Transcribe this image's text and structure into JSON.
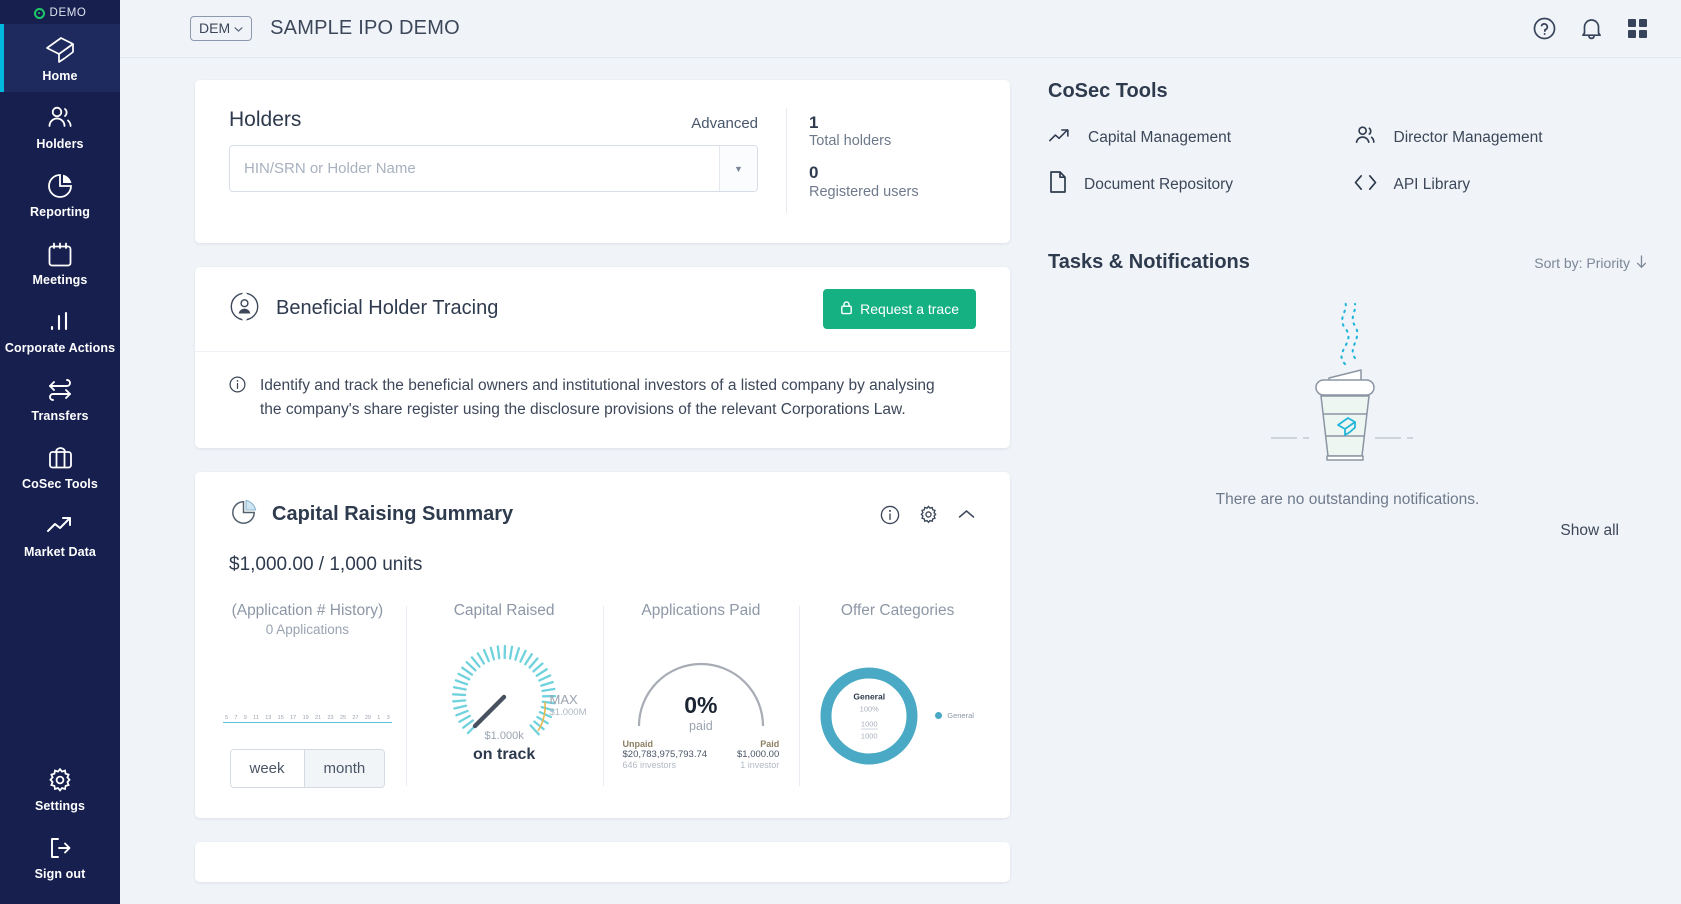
{
  "sidebar": {
    "demo_badge": "DEMO",
    "items": [
      {
        "label": "Home",
        "icon": "logo-icon",
        "active": true
      },
      {
        "label": "Holders",
        "icon": "people-icon",
        "active": false
      },
      {
        "label": "Reporting",
        "icon": "pie-chart-icon",
        "active": false
      },
      {
        "label": "Meetings",
        "icon": "calendar-icon",
        "active": false
      },
      {
        "label": "Corporate Actions",
        "icon": "bar-chart-icon",
        "active": false
      },
      {
        "label": "Transfers",
        "icon": "transfer-arrows-icon",
        "active": false
      },
      {
        "label": "CoSec Tools",
        "icon": "briefcase-icon",
        "active": false
      },
      {
        "label": "Market Data",
        "icon": "trending-up-icon",
        "active": false
      }
    ],
    "bottom_items": [
      {
        "label": "Settings",
        "icon": "gear-icon"
      },
      {
        "label": "Sign out",
        "icon": "sign-out-icon"
      }
    ]
  },
  "topbar": {
    "ticker": "DEM",
    "company": "SAMPLE IPO DEMO",
    "icons": [
      "help-circle-icon",
      "bell-icon",
      "grid-apps-icon"
    ]
  },
  "holders": {
    "title": "Holders",
    "advanced_label": "Advanced",
    "search_placeholder": "HIN/SRN or Holder Name",
    "search_value": "",
    "stats": [
      {
        "value": "1",
        "label": "Total holders"
      },
      {
        "value": "0",
        "label": "Registered users"
      }
    ]
  },
  "beneficial_holder_tracing": {
    "title": "Beneficial Holder Tracing",
    "button_label": "Request a trace",
    "description": "Identify and track the beneficial owners and institutional investors of a listed company by analysing the company's share register using the disclosure provisions of the relevant Corporations Law."
  },
  "capital_raising": {
    "title": "Capital Raising Summary",
    "amount": "$1,000.00 / 1,000 units",
    "actions": [
      "info-icon",
      "gear-icon",
      "chevron-up-icon"
    ]
  },
  "chart_data": [
    {
      "type": "bar",
      "title": "(Application # History)",
      "subtitle": "0 Applications",
      "categories": [
        "5",
        "7",
        "9",
        "11",
        "13",
        "15",
        "17",
        "19",
        "21",
        "23",
        "25",
        "27",
        "29",
        "1",
        "3"
      ],
      "values": [
        0,
        0,
        0,
        0,
        0,
        0,
        0,
        0,
        0,
        0,
        0,
        0,
        0,
        0,
        0
      ],
      "xlabel": "",
      "ylabel": "",
      "ylim": [
        0,
        1
      ],
      "grid": false,
      "range_toggle": {
        "options": [
          "week",
          "month"
        ],
        "selected": "month"
      },
      "axis_color": "#57c2d6"
    },
    {
      "type": "gauge",
      "title": "Capital Raised",
      "value_label": "$1.000k",
      "status_label": "on track",
      "max_label": "MAX",
      "max_value": "$1.000M",
      "percent": 0.1,
      "tick_color": "#6fd2dd",
      "warn_color": "#e8b84b"
    },
    {
      "type": "gauge",
      "title": "Applications Paid",
      "center_value": "0%",
      "center_label": "paid",
      "percent": 0,
      "arc_color": "#a8adb5",
      "segments": [
        {
          "name": "Unpaid",
          "amount": "$20,783,975,793.74",
          "detail": "646 investors"
        },
        {
          "name": "Paid",
          "amount": "$1,000.00",
          "detail": "1 investor"
        }
      ]
    },
    {
      "type": "pie",
      "title": "Offer Categories",
      "labels": [
        "General"
      ],
      "values": [
        1000
      ],
      "total": 1000,
      "center_name": "General",
      "center_pct": "100%",
      "center_num": "1000",
      "center_den": "1000",
      "legend": [
        "General"
      ],
      "colors": [
        "#4aa9c4"
      ],
      "legend_position": "right"
    }
  ],
  "cosec_tools": {
    "heading": "CoSec Tools",
    "items": [
      {
        "label": "Capital Management",
        "icon": "trending-up-icon"
      },
      {
        "label": "Director Management",
        "icon": "people-icon"
      },
      {
        "label": "Document Repository",
        "icon": "document-icon"
      },
      {
        "label": "API Library",
        "icon": "code-brackets-icon"
      }
    ]
  },
  "tasks_notifications": {
    "heading": "Tasks & Notifications",
    "sort_label": "Sort by: Priority",
    "empty_message": "There are no outstanding notifications.",
    "show_all_label": "Show all",
    "illustration": "coffee-cup-icon"
  },
  "colors": {
    "sidebar_bg": "#161f4e",
    "accent_cyan": "#00b7e0",
    "accent_green": "#16b183",
    "demo_green": "#1fc96a",
    "teal": "#4aa9c4",
    "page_bg": "#f0f4f8"
  }
}
